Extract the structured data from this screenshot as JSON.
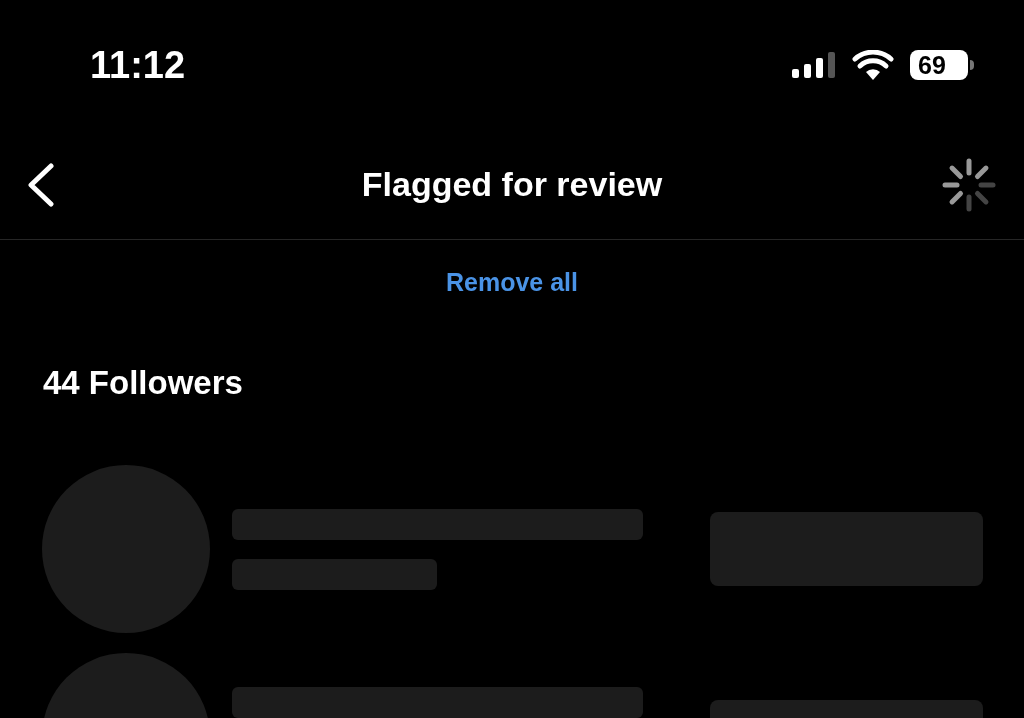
{
  "status_bar": {
    "time": "11:12",
    "battery": "69"
  },
  "nav": {
    "title": "Flagged for review"
  },
  "remove_all": "Remove all",
  "section_title": "44 Followers",
  "rows": [
    {
      "kind": "skeleton"
    },
    {
      "kind": "skeleton_cut"
    }
  ]
}
